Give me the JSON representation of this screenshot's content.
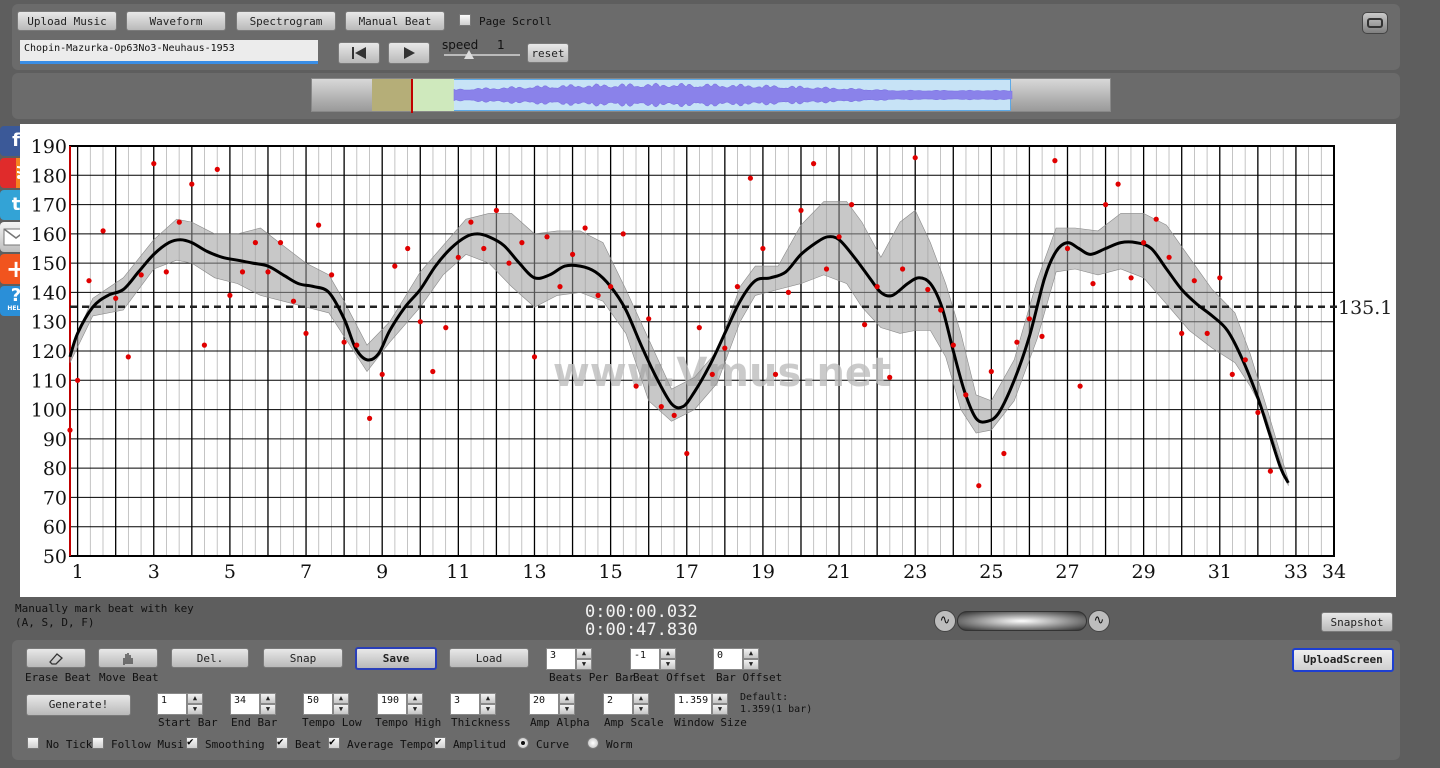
{
  "toolbar": {
    "upload_music": "Upload Music",
    "waveform": "Waveform",
    "spectrogram": "Spectrogram",
    "manual_beat": "Manual Beat",
    "page_scroll": "Page Scroll",
    "file_name": "Chopin-Mazurka-Op63No3-Neuhaus-1953",
    "speed_label": "speed",
    "speed_value": "1",
    "reset": "reset"
  },
  "chart_data": {
    "type": "scatter",
    "title": "",
    "xlabel": "",
    "ylabel": "",
    "xlim": [
      0.8,
      34
    ],
    "ylim": [
      50,
      190
    ],
    "grid": true,
    "x_tick_labels": [
      1,
      3,
      5,
      7,
      9,
      11,
      13,
      15,
      17,
      19,
      21,
      23,
      25,
      27,
      29,
      31,
      33,
      34
    ],
    "y_ticks": [
      50,
      60,
      70,
      80,
      90,
      100,
      110,
      120,
      130,
      140,
      150,
      160,
      170,
      180,
      190
    ],
    "average_tempo": 135.1,
    "average_label": "135.1",
    "watermark": "www.Vmus.net",
    "beats": [
      [
        0.8,
        93
      ],
      [
        1.0,
        110
      ],
      [
        1.3,
        144
      ],
      [
        1.67,
        161
      ],
      [
        2.0,
        138
      ],
      [
        2.33,
        118
      ],
      [
        2.67,
        146
      ],
      [
        3.0,
        184
      ],
      [
        3.33,
        147
      ],
      [
        3.67,
        164
      ],
      [
        4.0,
        177
      ],
      [
        4.33,
        122
      ],
      [
        4.67,
        182
      ],
      [
        5.0,
        139
      ],
      [
        5.33,
        147
      ],
      [
        5.67,
        157
      ],
      [
        6.0,
        147
      ],
      [
        6.33,
        157
      ],
      [
        6.67,
        137
      ],
      [
        7.0,
        126
      ],
      [
        7.33,
        163
      ],
      [
        7.67,
        146
      ],
      [
        8.0,
        123
      ],
      [
        8.33,
        122
      ],
      [
        8.67,
        97
      ],
      [
        9.0,
        112
      ],
      [
        9.33,
        149
      ],
      [
        9.67,
        155
      ],
      [
        10.0,
        130
      ],
      [
        10.33,
        113
      ],
      [
        10.67,
        128
      ],
      [
        11.0,
        152
      ],
      [
        11.33,
        164
      ],
      [
        11.67,
        155
      ],
      [
        12.0,
        168
      ],
      [
        12.33,
        150
      ],
      [
        12.67,
        157
      ],
      [
        13.0,
        118
      ],
      [
        13.33,
        159
      ],
      [
        13.67,
        142
      ],
      [
        14.0,
        153
      ],
      [
        14.33,
        162
      ],
      [
        14.67,
        139
      ],
      [
        15.0,
        142
      ],
      [
        15.33,
        160
      ],
      [
        15.67,
        108
      ],
      [
        16.0,
        131
      ],
      [
        16.33,
        101
      ],
      [
        16.67,
        98
      ],
      [
        17.0,
        85
      ],
      [
        17.33,
        128
      ],
      [
        17.67,
        112
      ],
      [
        18.0,
        121
      ],
      [
        18.33,
        142
      ],
      [
        18.67,
        179
      ],
      [
        19.0,
        155
      ],
      [
        19.33,
        112
      ],
      [
        19.67,
        140
      ],
      [
        20.0,
        168
      ],
      [
        20.33,
        184
      ],
      [
        20.67,
        148
      ],
      [
        21.0,
        159
      ],
      [
        21.33,
        170
      ],
      [
        21.67,
        129
      ],
      [
        22.0,
        142
      ],
      [
        22.33,
        111
      ],
      [
        22.67,
        148
      ],
      [
        23.0,
        186
      ],
      [
        23.33,
        141
      ],
      [
        23.67,
        134
      ],
      [
        24.0,
        122
      ],
      [
        24.33,
        105
      ],
      [
        24.67,
        74
      ],
      [
        25.0,
        113
      ],
      [
        25.33,
        85
      ],
      [
        25.67,
        123
      ],
      [
        26.0,
        131
      ],
      [
        26.33,
        125
      ],
      [
        26.67,
        185
      ],
      [
        27.0,
        155
      ],
      [
        27.33,
        108
      ],
      [
        27.67,
        143
      ],
      [
        28.0,
        170
      ],
      [
        28.33,
        177
      ],
      [
        28.67,
        145
      ],
      [
        29.0,
        157
      ],
      [
        29.33,
        165
      ],
      [
        29.67,
        152
      ],
      [
        30.0,
        126
      ],
      [
        30.33,
        144
      ],
      [
        30.67,
        126
      ],
      [
        31.0,
        145
      ],
      [
        31.33,
        112
      ],
      [
        31.67,
        117
      ],
      [
        32.0,
        99
      ],
      [
        32.33,
        79
      ]
    ],
    "smooth_curve": [
      [
        0.8,
        118
      ],
      [
        1.0,
        126
      ],
      [
        1.4,
        135
      ],
      [
        1.8,
        139
      ],
      [
        2.2,
        141
      ],
      [
        2.6,
        147
      ],
      [
        3.0,
        153
      ],
      [
        3.4,
        157
      ],
      [
        3.7,
        158
      ],
      [
        4.0,
        157
      ],
      [
        4.4,
        154
      ],
      [
        4.8,
        152
      ],
      [
        5.2,
        151
      ],
      [
        5.6,
        150
      ],
      [
        6.0,
        149
      ],
      [
        6.4,
        146
      ],
      [
        6.8,
        143
      ],
      [
        7.2,
        142
      ],
      [
        7.6,
        140
      ],
      [
        8.0,
        131
      ],
      [
        8.3,
        121
      ],
      [
        8.6,
        117
      ],
      [
        8.9,
        119
      ],
      [
        9.2,
        127
      ],
      [
        9.6,
        135
      ],
      [
        10.0,
        141
      ],
      [
        10.4,
        149
      ],
      [
        10.8,
        155
      ],
      [
        11.2,
        159
      ],
      [
        11.5,
        160
      ],
      [
        11.8,
        159
      ],
      [
        12.2,
        156
      ],
      [
        12.6,
        150
      ],
      [
        13.0,
        145
      ],
      [
        13.4,
        146
      ],
      [
        13.8,
        149
      ],
      [
        14.2,
        149
      ],
      [
        14.6,
        147
      ],
      [
        15.0,
        142
      ],
      [
        15.4,
        134
      ],
      [
        15.8,
        122
      ],
      [
        16.2,
        111
      ],
      [
        16.6,
        102
      ],
      [
        16.9,
        101
      ],
      [
        17.2,
        106
      ],
      [
        17.6,
        115
      ],
      [
        18.0,
        126
      ],
      [
        18.4,
        137
      ],
      [
        18.8,
        144
      ],
      [
        19.2,
        145
      ],
      [
        19.6,
        147
      ],
      [
        20.0,
        153
      ],
      [
        20.4,
        157
      ],
      [
        20.7,
        159
      ],
      [
        21.0,
        158
      ],
      [
        21.4,
        152
      ],
      [
        21.8,
        145
      ],
      [
        22.1,
        140
      ],
      [
        22.4,
        139
      ],
      [
        22.8,
        143
      ],
      [
        23.1,
        145
      ],
      [
        23.4,
        143
      ],
      [
        23.7,
        135
      ],
      [
        24.0,
        120
      ],
      [
        24.3,
        106
      ],
      [
        24.6,
        97
      ],
      [
        24.9,
        96
      ],
      [
        25.2,
        99
      ],
      [
        25.6,
        110
      ],
      [
        26.0,
        125
      ],
      [
        26.4,
        145
      ],
      [
        26.7,
        154
      ],
      [
        27.0,
        157
      ],
      [
        27.3,
        155
      ],
      [
        27.6,
        153
      ],
      [
        28.0,
        155
      ],
      [
        28.4,
        157
      ],
      [
        28.8,
        157
      ],
      [
        29.2,
        155
      ],
      [
        29.6,
        148
      ],
      [
        30.0,
        141
      ],
      [
        30.4,
        136
      ],
      [
        30.8,
        132
      ],
      [
        31.2,
        127
      ],
      [
        31.6,
        117
      ],
      [
        32.0,
        104
      ],
      [
        32.3,
        92
      ],
      [
        32.6,
        80
      ],
      [
        32.8,
        75
      ]
    ],
    "band_upper": [
      [
        0.8,
        120
      ],
      [
        1.4,
        138
      ],
      [
        2.2,
        145
      ],
      [
        3.0,
        158
      ],
      [
        3.6,
        165
      ],
      [
        4.0,
        164
      ],
      [
        4.6,
        160
      ],
      [
        5.2,
        160
      ],
      [
        5.8,
        162
      ],
      [
        6.4,
        156
      ],
      [
        7.0,
        150
      ],
      [
        7.6,
        146
      ],
      [
        8.0,
        137
      ],
      [
        8.6,
        122
      ],
      [
        9.2,
        130
      ],
      [
        10.0,
        147
      ],
      [
        10.6,
        156
      ],
      [
        11.2,
        165
      ],
      [
        11.8,
        167
      ],
      [
        12.4,
        167
      ],
      [
        13.0,
        160
      ],
      [
        13.6,
        161
      ],
      [
        14.2,
        161
      ],
      [
        14.8,
        157
      ],
      [
        15.4,
        141
      ],
      [
        16.0,
        124
      ],
      [
        16.6,
        107
      ],
      [
        17.2,
        111
      ],
      [
        17.8,
        120
      ],
      [
        18.4,
        142
      ],
      [
        18.8,
        149
      ],
      [
        19.4,
        149
      ],
      [
        20.0,
        163
      ],
      [
        20.6,
        171
      ],
      [
        21.2,
        171
      ],
      [
        21.6,
        164
      ],
      [
        22.1,
        152
      ],
      [
        22.6,
        164
      ],
      [
        23.0,
        168
      ],
      [
        23.4,
        157
      ],
      [
        23.8,
        143
      ],
      [
        24.2,
        126
      ],
      [
        24.6,
        105
      ],
      [
        25.0,
        103
      ],
      [
        25.6,
        117
      ],
      [
        26.2,
        144
      ],
      [
        26.7,
        162
      ],
      [
        27.2,
        162
      ],
      [
        27.8,
        161
      ],
      [
        28.4,
        167
      ],
      [
        29.0,
        167
      ],
      [
        29.6,
        163
      ],
      [
        30.2,
        152
      ],
      [
        30.8,
        141
      ],
      [
        31.4,
        133
      ],
      [
        31.8,
        119
      ],
      [
        32.2,
        102
      ],
      [
        32.8,
        76
      ]
    ],
    "band_lower": [
      [
        0.8,
        116
      ],
      [
        1.4,
        132
      ],
      [
        2.2,
        134
      ],
      [
        3.0,
        148
      ],
      [
        3.6,
        151
      ],
      [
        4.0,
        150
      ],
      [
        4.6,
        145
      ],
      [
        5.2,
        143
      ],
      [
        5.8,
        139
      ],
      [
        6.4,
        137
      ],
      [
        7.0,
        135
      ],
      [
        7.6,
        133
      ],
      [
        8.0,
        125
      ],
      [
        8.6,
        113
      ],
      [
        9.2,
        123
      ],
      [
        10.0,
        135
      ],
      [
        10.6,
        146
      ],
      [
        11.2,
        153
      ],
      [
        11.8,
        150
      ],
      [
        12.4,
        142
      ],
      [
        13.0,
        135
      ],
      [
        13.6,
        139
      ],
      [
        14.2,
        140
      ],
      [
        14.8,
        137
      ],
      [
        15.4,
        126
      ],
      [
        16.0,
        103
      ],
      [
        16.6,
        96
      ],
      [
        17.2,
        100
      ],
      [
        17.8,
        109
      ],
      [
        18.4,
        130
      ],
      [
        18.8,
        139
      ],
      [
        19.4,
        141
      ],
      [
        20.0,
        143
      ],
      [
        20.6,
        146
      ],
      [
        21.2,
        143
      ],
      [
        21.6,
        135
      ],
      [
        22.1,
        128
      ],
      [
        22.6,
        126
      ],
      [
        23.0,
        127
      ],
      [
        23.4,
        127
      ],
      [
        23.8,
        118
      ],
      [
        24.2,
        100
      ],
      [
        24.6,
        92
      ],
      [
        25.0,
        93
      ],
      [
        25.6,
        103
      ],
      [
        26.2,
        124
      ],
      [
        26.7,
        147
      ],
      [
        27.2,
        148
      ],
      [
        27.8,
        146
      ],
      [
        28.4,
        148
      ],
      [
        29.0,
        145
      ],
      [
        29.6,
        136
      ],
      [
        30.2,
        127
      ],
      [
        30.8,
        121
      ],
      [
        31.4,
        116
      ],
      [
        31.8,
        108
      ],
      [
        32.2,
        98
      ],
      [
        32.8,
        74
      ]
    ]
  },
  "status": {
    "hint_line1": "Manually mark beat with key",
    "hint_line2": "(A, S, D, F)",
    "time_current": "0:00:00.032",
    "time_total": "0:00:47.830",
    "snapshot": "Snapshot"
  },
  "controls": {
    "erase_beat": "Erase Beat",
    "move_beat": "Move Beat",
    "del": "Del.",
    "snap": "Snap",
    "save": "Save",
    "load": "Load",
    "beats_per_bar_value": "3",
    "beats_per_bar_label": "Beats Per Bar",
    "beat_offset_value": "-1",
    "beat_offset_label": "Beat Offset",
    "bar_offset_value": "0",
    "bar_offset_label": "Bar Offset",
    "upload_screen": "UploadScreen",
    "generate": "Generate!",
    "start_bar_value": "1",
    "start_bar_label": "Start Bar",
    "end_bar_value": "34",
    "end_bar_label": "End Bar",
    "tempo_low_value": "50",
    "tempo_low_label": "Tempo Low",
    "tempo_high_value": "190",
    "tempo_high_label": "Tempo High",
    "thickness_value": "3",
    "thickness_label": "Thickness",
    "amp_alpha_value": "20",
    "amp_alpha_label": "Amp Alpha",
    "amp_scale_value": "2",
    "amp_scale_label": "Amp Scale",
    "window_size_value": "1.359",
    "window_size_label": "Window Size",
    "default_line1": "Default:",
    "default_line2": "1.359(1 bar)",
    "no_tick": "No Tick",
    "follow_music": "Follow Musi",
    "smoothing": "Smoothing",
    "beat": "Beat",
    "average_tempo": "Average Tempo",
    "amplitude": "Amplitud",
    "curve": "Curve",
    "worm": "Worm"
  },
  "social": {
    "facebook": "f",
    "twitter": "t",
    "plus": "+",
    "help": "?",
    "help_text": "HELP"
  }
}
